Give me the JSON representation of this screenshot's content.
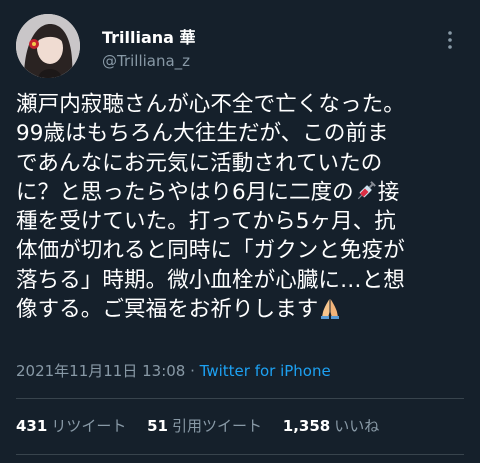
{
  "user": {
    "display_name": "Trilliana 華",
    "handle": "@Trilliana_z"
  },
  "tweet": {
    "lines": [
      "瀬戸内寂聴さんが心不全で亡くなった。",
      "99歳はもちろん大往生だが、この前ま",
      "であんなにお元気に活動されていたの",
      "に？と思ったらやはり6月に二度の",
      "接",
      "種を受けていた。打ってから5ヶ月、抗",
      "体価が切れると同時に「ガクンと免疫が",
      "落ちる」時期。微小血栓が心臓に…と想",
      "像する。ご冥福をお祈りします"
    ],
    "emoji_syringe": "syringe-emoji",
    "emoji_pray": "folded-hands-emoji"
  },
  "meta": {
    "timestamp": "2021年11月11日 13:08",
    "separator": " · ",
    "source": "Twitter for iPhone"
  },
  "stats": {
    "retweets_count": "431",
    "retweets_label": "リツイート",
    "quotes_count": "51",
    "quotes_label": "引用ツイート",
    "likes_count": "1,358",
    "likes_label": "いいね"
  },
  "colors": {
    "background": "#15202b",
    "text": "#ffffff",
    "secondary": "#8899a6",
    "link": "#1da1f2",
    "divider": "#38444d"
  }
}
